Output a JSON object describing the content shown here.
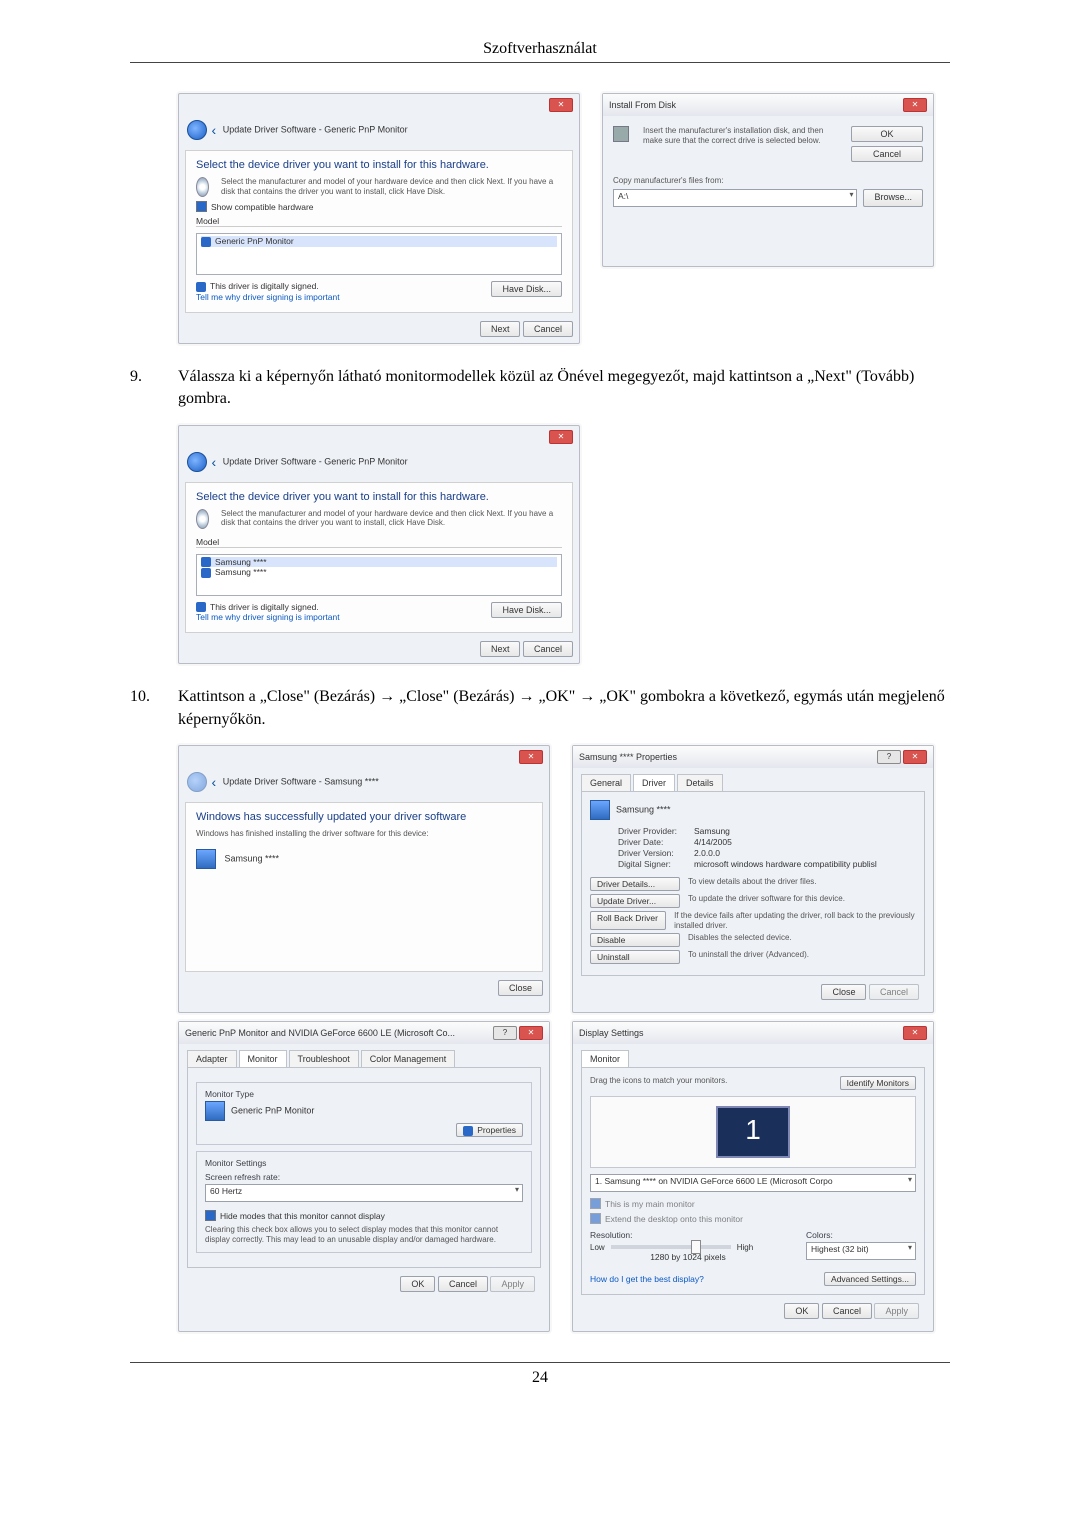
{
  "header": {
    "title": "Szoftverhasználat"
  },
  "step9": {
    "num": "9.",
    "text": "Válassza ki a képernyőn látható monitormodellek közül az Önével megegyezőt, majd kattintson a „Next\" (Tovább) gombra."
  },
  "step10": {
    "num": "10.",
    "text": "Kattintson a „Close\" (Bezárás) → „Close\" (Bezárás) → „OK\" → „OK\" gombokra a következő, egymás után megjelenő képernyőkön."
  },
  "wiz1": {
    "breadcrumb": "Update Driver Software - Generic PnP Monitor",
    "heading": "Select the device driver you want to install for this hardware.",
    "desc": "Select the manufacturer and model of your hardware device and then click Next. If you have a disk that contains the driver you want to install, click Have Disk.",
    "compat": "Show compatible hardware",
    "model_label": "Model",
    "model_item": "Generic PnP Monitor",
    "signed": "This driver is digitally signed.",
    "tell": "Tell me why driver signing is important",
    "have_disk": "Have Disk...",
    "next": "Next",
    "cancel": "Cancel"
  },
  "install_disk": {
    "title": "Install From Disk",
    "msg": "Insert the manufacturer's installation disk, and then make sure that the correct drive is selected below.",
    "ok": "OK",
    "cancel": "Cancel",
    "copy_label": "Copy manufacturer's files from:",
    "path": "A:\\",
    "browse": "Browse..."
  },
  "wiz2": {
    "breadcrumb": "Update Driver Software - Generic PnP Monitor",
    "heading": "Select the device driver you want to install for this hardware.",
    "desc": "Select the manufacturer and model of your hardware device and then click Next. If you have a disk that contains the driver you want to install, click Have Disk.",
    "model_label": "Model",
    "m1": "Samsung ****",
    "m2": "Samsung ****",
    "signed": "This driver is digitally signed.",
    "tell": "Tell me why driver signing is important",
    "have_disk": "Have Disk...",
    "next": "Next",
    "cancel": "Cancel"
  },
  "wiz3": {
    "breadcrumb": "Update Driver Software - Samsung ****",
    "heading": "Windows has successfully updated your driver software",
    "desc": "Windows has finished installing the driver software for this device:",
    "device": "Samsung ****",
    "close": "Close"
  },
  "props": {
    "title": "Samsung **** Properties",
    "tab_general": "General",
    "tab_driver": "Driver",
    "tab_details": "Details",
    "device": "Samsung ****",
    "f_provider_l": "Driver Provider:",
    "f_provider_v": "Samsung",
    "f_date_l": "Driver Date:",
    "f_date_v": "4/14/2005",
    "f_ver_l": "Driver Version:",
    "f_ver_v": "2.0.0.0",
    "f_signer_l": "Digital Signer:",
    "f_signer_v": "microsoft windows hardware compatibility publisl",
    "b_details": "Driver Details...",
    "b_details_d": "To view details about the driver files.",
    "b_update": "Update Driver...",
    "b_update_d": "To update the driver software for this device.",
    "b_roll": "Roll Back Driver",
    "b_roll_d": "If the device fails after updating the driver, roll back to the previously installed driver.",
    "b_disable": "Disable",
    "b_disable_d": "Disables the selected device.",
    "b_uninstall": "Uninstall",
    "b_uninstall_d": "To uninstall the driver (Advanced).",
    "close": "Close",
    "cancel": "Cancel"
  },
  "pnp": {
    "title": "Generic PnP Monitor and NVIDIA GeForce 6600 LE (Microsoft Co...",
    "tab_adapter": "Adapter",
    "tab_monitor": "Monitor",
    "tab_trouble": "Troubleshoot",
    "tab_color": "Color Management",
    "mtype": "Monitor Type",
    "mtype_v": "Generic PnP Monitor",
    "properties": "Properties",
    "msettings": "Monitor Settings",
    "refresh_l": "Screen refresh rate:",
    "refresh_v": "60 Hertz",
    "hide": "Hide modes that this monitor cannot display",
    "hide_desc": "Clearing this check box allows you to select display modes that this monitor cannot display correctly. This may lead to an unusable display and/or damaged hardware.",
    "ok": "OK",
    "cancel": "Cancel",
    "apply": "Apply"
  },
  "disp": {
    "title": "Display Settings",
    "tab_monitor": "Monitor",
    "drag": "Drag the icons to match your monitors.",
    "identify": "Identify Monitors",
    "num": "1",
    "combo": "1. Samsung **** on NVIDIA GeForce 6600 LE (Microsoft Corpo",
    "main": "This is my main monitor",
    "extend": "Extend the desktop onto this monitor",
    "res_l": "Resolution:",
    "low": "Low",
    "high": "High",
    "res_v": "1280 by 1024 pixels",
    "col_l": "Colors:",
    "col_v": "Highest (32 bit)",
    "best": "How do I get the best display?",
    "adv": "Advanced Settings...",
    "ok": "OK",
    "cancel": "Cancel",
    "apply": "Apply"
  },
  "footer": {
    "pageno": "24"
  }
}
